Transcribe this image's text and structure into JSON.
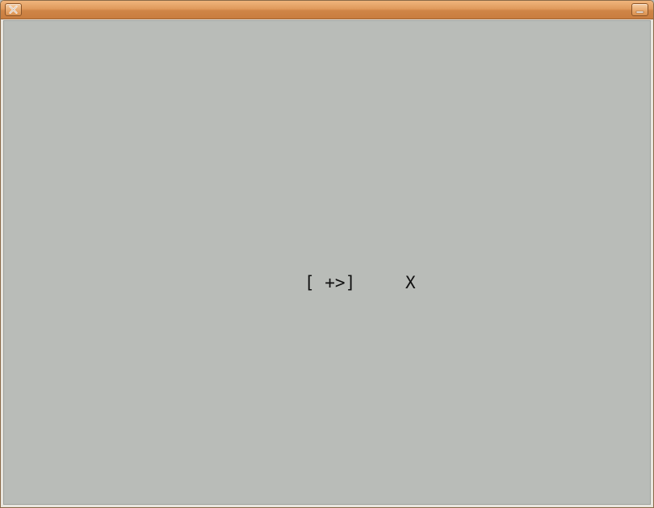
{
  "window": {
    "title": "",
    "buttons": {
      "close_icon": "close-icon",
      "minimize_icon": "minimize-icon"
    },
    "colors": {
      "titlebar": "#e09a5c",
      "client_background": "#b9bcb8",
      "text": "#111111"
    }
  },
  "content": {
    "prompt_text": "[ +>]",
    "marker_text": "X"
  }
}
